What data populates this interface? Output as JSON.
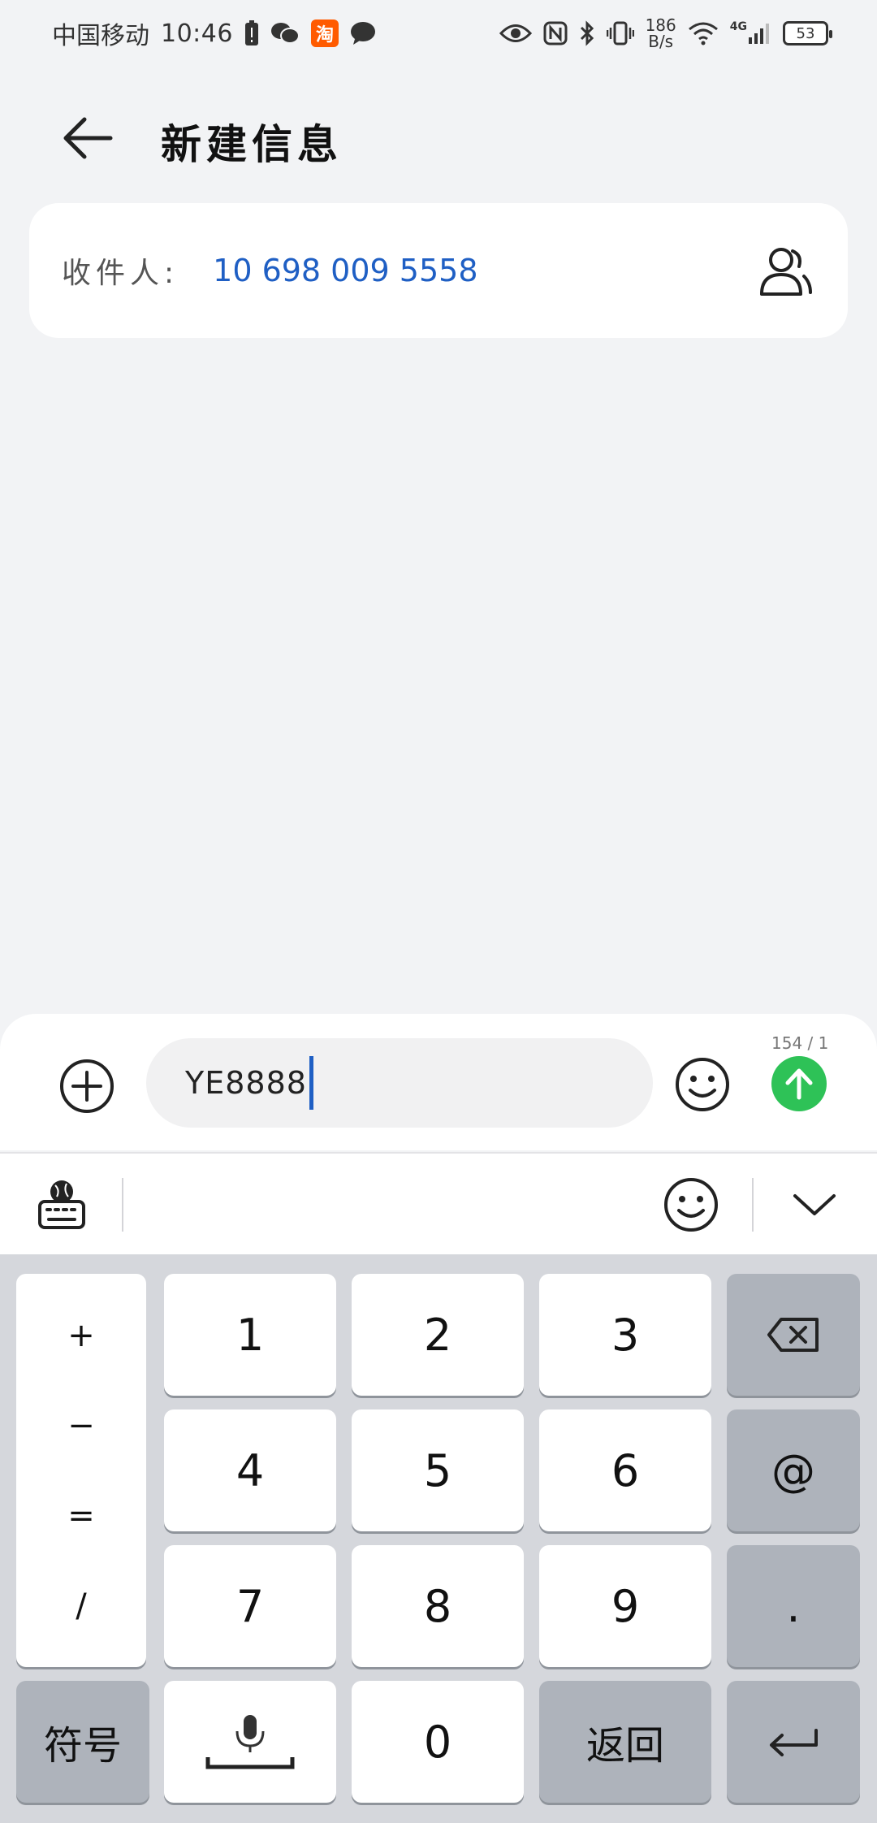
{
  "status_bar": {
    "carrier": "中国移动",
    "time": "10:46",
    "taobao_label": "淘",
    "net_speed_value": "186",
    "net_speed_unit": "B/s",
    "network_type": "4G",
    "battery": "53"
  },
  "header": {
    "title": "新建信息"
  },
  "recipient": {
    "label": "收件人:",
    "number": "10 698 009 5558"
  },
  "compose": {
    "message_text": "YE8888",
    "counter": "154 / 1",
    "accent_color": "#2ec257"
  },
  "keyboard": {
    "symbols_column": [
      "+",
      "−",
      "=",
      "/"
    ],
    "digit_keys": [
      "1",
      "2",
      "3",
      "4",
      "5",
      "6",
      "7",
      "8",
      "9",
      "0"
    ],
    "at_key": "@",
    "dot_key": ".",
    "symbols_key": "符号",
    "return_key": "返回"
  }
}
